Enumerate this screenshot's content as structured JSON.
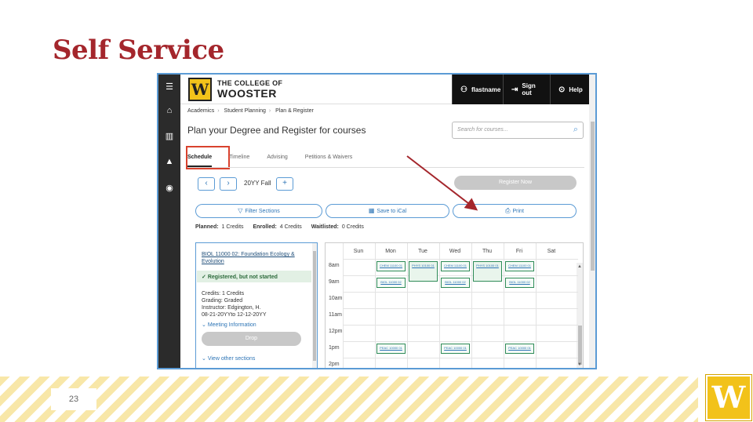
{
  "slide": {
    "title": "Self Service",
    "page_number": "23",
    "logo_letter": "W"
  },
  "app": {
    "rail_icons": [
      "menu-icon",
      "home-icon",
      "bank-icon",
      "graduation-cap-icon",
      "user-circle-icon"
    ],
    "logo": {
      "letter": "W",
      "line1": "THE COLLEGE OF",
      "line2": "WOOSTER"
    },
    "topnav": [
      {
        "icon": "user-icon",
        "label": "flastname"
      },
      {
        "icon": "sign-out-icon",
        "label": "Sign out"
      },
      {
        "icon": "help-icon",
        "label": "Help"
      }
    ],
    "breadcrumb": [
      "Academics",
      "Student Planning",
      "Plan & Register"
    ],
    "page_title": "Plan your Degree and Register for courses",
    "search_placeholder": "Search for courses...",
    "tabs": [
      {
        "label": "Schedule",
        "active": true
      },
      {
        "label": "Timeline",
        "active": false
      },
      {
        "label": "Advising",
        "active": false
      },
      {
        "label": "Petitions & Waivers",
        "active": false
      }
    ],
    "term": "20YY Fall",
    "prev_label": "‹",
    "next_label": "›",
    "add_label": "+",
    "register_label": "Register Now",
    "actions": {
      "filter_label": "Filter Sections",
      "ical_label": "Save to iCal",
      "print_label": "Print"
    },
    "credits": {
      "planned_label": "Planned:",
      "planned_value": "1 Credits",
      "enrolled_label": "Enrolled:",
      "enrolled_value": "4 Credits",
      "waitlisted_label": "Waitlisted:",
      "waitlisted_value": "0 Credits"
    },
    "course": {
      "title": "BIOL 11000 02: Foundation Ecology & Evolution",
      "status": "Registered, but not started",
      "credits": "Credits: 1 Credits",
      "grading": "Grading: Graded",
      "instructor": "Instructor: Edgington, H.",
      "dates": "08-21-20YYto 12-12-20YY",
      "meeting_info": "Meeting Information",
      "drop_label": "Drop",
      "view_other": "View other sections"
    },
    "calendar": {
      "days": [
        "Sun",
        "Mon",
        "Tue",
        "Wed",
        "Thu",
        "Fri",
        "Sat"
      ],
      "times": [
        "8am",
        "9am",
        "10am",
        "11am",
        "12pm",
        "1pm",
        "2pm"
      ],
      "events": [
        {
          "day": 1,
          "row": 0,
          "label": "CHEM 11100 01"
        },
        {
          "day": 2,
          "row": 0,
          "label": "PHYS 10100 01",
          "tall": true
        },
        {
          "day": 3,
          "row": 0,
          "label": "CHEM 11100 01"
        },
        {
          "day": 4,
          "row": 0,
          "label": "PHYS 10100 01",
          "tall": true
        },
        {
          "day": 5,
          "row": 0,
          "label": "CHEM 11100 01"
        },
        {
          "day": 1,
          "row": 1,
          "label": "BIOL 11000 02"
        },
        {
          "day": 3,
          "row": 1,
          "label": "BIOL 11000 02"
        },
        {
          "day": 5,
          "row": 1,
          "label": "BIOL 11000 02"
        },
        {
          "day": 1,
          "row": 5,
          "label": "PEAC 10000 01"
        },
        {
          "day": 3,
          "row": 5,
          "label": "PEAC 10000 01"
        },
        {
          "day": 5,
          "row": 5,
          "label": "PEAC 10000 01"
        }
      ]
    }
  }
}
